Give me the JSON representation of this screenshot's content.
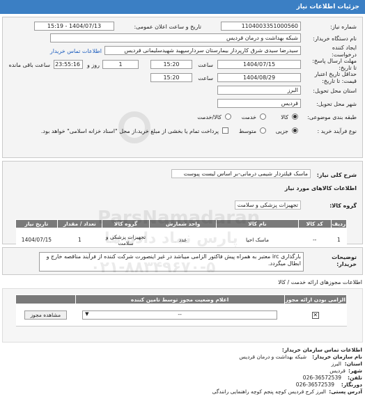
{
  "header": {
    "title": "جزئیات اطلاعات نیاز"
  },
  "form": {
    "need_number": {
      "label": "شماره نیاز:",
      "value": "1104003351000560"
    },
    "announce_datetime": {
      "label": "تاریخ و ساعت اعلان عمومی:",
      "value": "1404/07/13 - 15:19"
    },
    "buyer_org": {
      "label": "نام دستگاه خریدار:",
      "value": "شبکه بهداشت و درمان قردیس"
    },
    "creator": {
      "label": "ایجاد کننده درخواست:",
      "value": "سیدرضا سیدی شرق کارپرداز بیمارستان سردارسپهبد شهیدسلیمانی قردیس",
      "contact_link": "اطلاعات تماس خریدار"
    },
    "reply_deadline": {
      "label": "مهلت ارسال پاسخ: تا تاریخ:",
      "date": "1404/07/15",
      "time_label": "ساعت",
      "time": "15:20",
      "days": "1",
      "days_label": "روز و",
      "remaining": "23:55:16",
      "remaining_label": "ساعت باقی مانده"
    },
    "price_validity": {
      "label": "حداقل تاریخ اعتبار قیمت: تا تاریخ:",
      "date": "1404/08/29",
      "time_label": "ساعت",
      "time": "15:20"
    },
    "province": {
      "label": "استان محل تحویل:",
      "value": "البرز"
    },
    "city": {
      "label": "شهر محل تحویل:",
      "value": "قردیس"
    },
    "category": {
      "label": "طبقه بندی موضوعی:",
      "options": [
        "کالا",
        "خدمت",
        "کالا/خدمت"
      ],
      "selected": "کالا"
    },
    "purchase_process": {
      "label": "نوع فرآیند خرید :",
      "options": [
        "جزیی",
        "متوسط"
      ],
      "selected": "جزیی",
      "note": "پرداخت تمام یا بخشی از مبلغ خرید،از محل \"اسناد خزانه اسلامی\" خواهد بود."
    }
  },
  "description": {
    "label": "شرح کلی نیاز:",
    "value": "ماسک فیلتردار شیمی درمانی-بر اساس لیست پیوست"
  },
  "items_section": {
    "title": "اطلاعات کالاهای مورد نیاز",
    "group_label": "گروه کالا:",
    "group_value": "تجهیزات پزشکی و سلامت",
    "columns": [
      "ردیف",
      "کد کالا",
      "نام کالا",
      "واحد شمارش",
      "گروه کالا",
      "تعداد / مقدار",
      "تاریخ نیاز"
    ],
    "rows": [
      {
        "row": "1",
        "code": "--",
        "name": "ماسک احیا",
        "unit": "عدد",
        "group": "تجهیزات پزشکی و سلامت",
        "qty": "1",
        "date": "1404/07/15"
      }
    ]
  },
  "buyer_notes": {
    "label": "توضیحات خریدار:",
    "value": "بارگذاری irc معتبر به همراه پیش فاکتور الزامی میباشد در غیر اینصورت شرکت کننده از فرآیند مناقصه خارج و ابطال میگردد."
  },
  "permits": {
    "title": "اطلاعات مجوزهای ارائه خدمت / کالا",
    "columns": [
      "الزامی بودن ارائه مجوز",
      "اعلام وضعیت مجوز توسط تامین کننده",
      ""
    ],
    "row": {
      "status_value": "--",
      "view_button": "مشاهده مجوز"
    }
  },
  "contact": {
    "title": "اطلاعات تماس سازمان خریدار:",
    "org_label": "نام سازمان خریدار:",
    "org_value": "شبکه بهداشت و درمان قردیس",
    "province_label": "استان:",
    "province_value": "البرز",
    "city_label": "شهر:",
    "city_value": "قردیس",
    "phone_label": "تلفن:",
    "phone_value": "026-36572539",
    "fax_label": "دورنگار:",
    "fax_value": "026-36572539",
    "address_label": "آدرس پستی:",
    "address_value": "البرز کرج قردیس کوچه پنجم کوچه راهنمایی رانندگی"
  },
  "watermark": {
    "lines": [
      "ParsNamadaran",
      "پارس نماد داده ها",
      "۰۲۱-۸۸۳۴۹۶۷۰-۵"
    ]
  },
  "colors": {
    "header": "#3b7fc4",
    "panel": "#f4f4f4",
    "table_head": "#7a7a7a",
    "link": "#1f5fbf"
  }
}
